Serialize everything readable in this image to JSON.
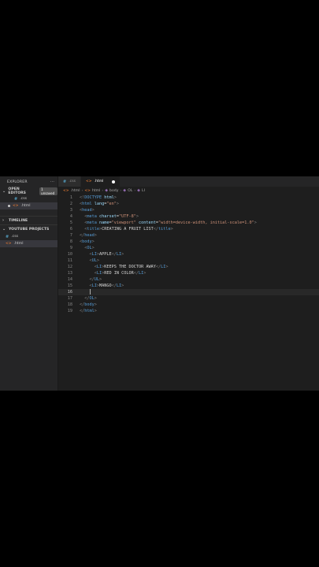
{
  "sidebar": {
    "title": "EXPLORER",
    "more_icon": "ellipsis-icon",
    "open_editors": {
      "label": "OPEN EDITORS",
      "badge": "1 unsaved",
      "files": [
        {
          "icon": "#",
          "name": ".css"
        },
        {
          "icon": "<>",
          "name": ".html",
          "modified": true
        }
      ]
    },
    "timeline": {
      "label": "TIMELINE"
    },
    "project": {
      "label": "YOUTUBE PROJECTS",
      "files": [
        {
          "icon": "#",
          "name": ".css"
        },
        {
          "icon": "<>",
          "name": ".html"
        }
      ]
    }
  },
  "tabs": [
    {
      "icon": "#",
      "label": ".css",
      "active": false
    },
    {
      "icon": "<>",
      "label": ".html",
      "active": true,
      "modified": true
    }
  ],
  "breadcrumb": {
    "items": [
      {
        "icon": "<>",
        "label": ".html"
      },
      {
        "icon": "<>",
        "label": "html"
      },
      {
        "icon": "cube-icon",
        "label": "body"
      },
      {
        "icon": "cube-icon",
        "label": "OL"
      },
      {
        "icon": "cube-icon",
        "label": "LI"
      }
    ]
  },
  "editor": {
    "current_line": 16,
    "lines": [
      {
        "n": "1",
        "indent": 0,
        "tokens": [
          [
            "br",
            "<!"
          ],
          [
            "tag",
            "DOCTYPE"
          ],
          [
            "txt",
            " "
          ],
          [
            "attr",
            "html"
          ],
          [
            "br",
            ">"
          ]
        ]
      },
      {
        "n": "2",
        "indent": 0,
        "tokens": [
          [
            "br",
            "<"
          ],
          [
            "tag",
            "html"
          ],
          [
            "txt",
            " "
          ],
          [
            "attr",
            "lang"
          ],
          [
            "txt",
            "="
          ],
          [
            "str",
            "\"en\""
          ],
          [
            "br",
            ">"
          ]
        ]
      },
      {
        "n": "3",
        "indent": 0,
        "tokens": [
          [
            "br",
            "<"
          ],
          [
            "tag",
            "head"
          ],
          [
            "br",
            ">"
          ]
        ]
      },
      {
        "n": "4",
        "indent": 2,
        "tokens": [
          [
            "br",
            "<"
          ],
          [
            "tag",
            "meta"
          ],
          [
            "txt",
            " "
          ],
          [
            "attr",
            "charset"
          ],
          [
            "txt",
            "="
          ],
          [
            "str",
            "\"UTF-8\""
          ],
          [
            "br",
            ">"
          ]
        ]
      },
      {
        "n": "5",
        "indent": 2,
        "tokens": [
          [
            "br",
            "<"
          ],
          [
            "tag",
            "meta"
          ],
          [
            "txt",
            " "
          ],
          [
            "attr",
            "name"
          ],
          [
            "txt",
            "="
          ],
          [
            "str",
            "\"viewport\""
          ],
          [
            "txt",
            " "
          ],
          [
            "attr",
            "content"
          ],
          [
            "txt",
            "="
          ],
          [
            "str",
            "\"width=device-width, initial-scale=1.0\""
          ],
          [
            "br",
            ">"
          ]
        ]
      },
      {
        "n": "6",
        "indent": 2,
        "tokens": [
          [
            "br",
            "<"
          ],
          [
            "tag",
            "title"
          ],
          [
            "br",
            ">"
          ],
          [
            "txt",
            "CREATING A FRUIT LIST"
          ],
          [
            "br",
            "</"
          ],
          [
            "tag",
            "title"
          ],
          [
            "br",
            ">"
          ]
        ]
      },
      {
        "n": "7",
        "indent": 0,
        "tokens": [
          [
            "br",
            "</"
          ],
          [
            "tag",
            "head"
          ],
          [
            "br",
            ">"
          ]
        ]
      },
      {
        "n": "8",
        "indent": 0,
        "tokens": [
          [
            "br",
            "<"
          ],
          [
            "tag",
            "body"
          ],
          [
            "br",
            ">"
          ]
        ]
      },
      {
        "n": "9",
        "indent": 2,
        "tokens": [
          [
            "br",
            "<"
          ],
          [
            "tag",
            "OL"
          ],
          [
            "br",
            ">"
          ]
        ]
      },
      {
        "n": "10",
        "indent": 4,
        "tokens": [
          [
            "br",
            "<"
          ],
          [
            "tag",
            "LI"
          ],
          [
            "br",
            ">"
          ],
          [
            "txt",
            "APPLE"
          ],
          [
            "br",
            "</"
          ],
          [
            "tag",
            "LI"
          ],
          [
            "br",
            ">"
          ]
        ]
      },
      {
        "n": "11",
        "indent": 4,
        "tokens": [
          [
            "br",
            "<"
          ],
          [
            "tag",
            "UL"
          ],
          [
            "br",
            ">"
          ]
        ]
      },
      {
        "n": "12",
        "indent": 6,
        "tokens": [
          [
            "br",
            "<"
          ],
          [
            "tag",
            "LI"
          ],
          [
            "br",
            ">"
          ],
          [
            "txt",
            "KEEPS THE DOCTOR AWAY"
          ],
          [
            "br",
            "</"
          ],
          [
            "tag",
            "LI"
          ],
          [
            "br",
            ">"
          ]
        ]
      },
      {
        "n": "13",
        "indent": 6,
        "tokens": [
          [
            "br",
            "<"
          ],
          [
            "tag",
            "LI"
          ],
          [
            "br",
            ">"
          ],
          [
            "txt",
            "RED IN COLOR"
          ],
          [
            "br",
            "</"
          ],
          [
            "tag",
            "LI"
          ],
          [
            "br",
            ">"
          ]
        ]
      },
      {
        "n": "14",
        "indent": 4,
        "tokens": [
          [
            "br",
            "</"
          ],
          [
            "tag",
            "UL"
          ],
          [
            "br",
            ">"
          ]
        ]
      },
      {
        "n": "15",
        "indent": 4,
        "tokens": [
          [
            "br",
            "<"
          ],
          [
            "tag",
            "LI"
          ],
          [
            "br",
            ">"
          ],
          [
            "txt",
            "MANGO"
          ],
          [
            "br",
            "</"
          ],
          [
            "tag",
            "LI"
          ],
          [
            "br",
            ">"
          ]
        ]
      },
      {
        "n": "16",
        "indent": 4,
        "tokens": []
      },
      {
        "n": "17",
        "indent": 2,
        "tokens": [
          [
            "br",
            "</"
          ],
          [
            "tag",
            "OL"
          ],
          [
            "br",
            ">"
          ]
        ]
      },
      {
        "n": "18",
        "indent": 0,
        "tokens": [
          [
            "br",
            "</"
          ],
          [
            "tag",
            "body"
          ],
          [
            "br",
            ">"
          ]
        ]
      },
      {
        "n": "19",
        "indent": 0,
        "tokens": [
          [
            "br",
            "</"
          ],
          [
            "tag",
            "html"
          ],
          [
            "br",
            ">"
          ]
        ]
      }
    ]
  }
}
